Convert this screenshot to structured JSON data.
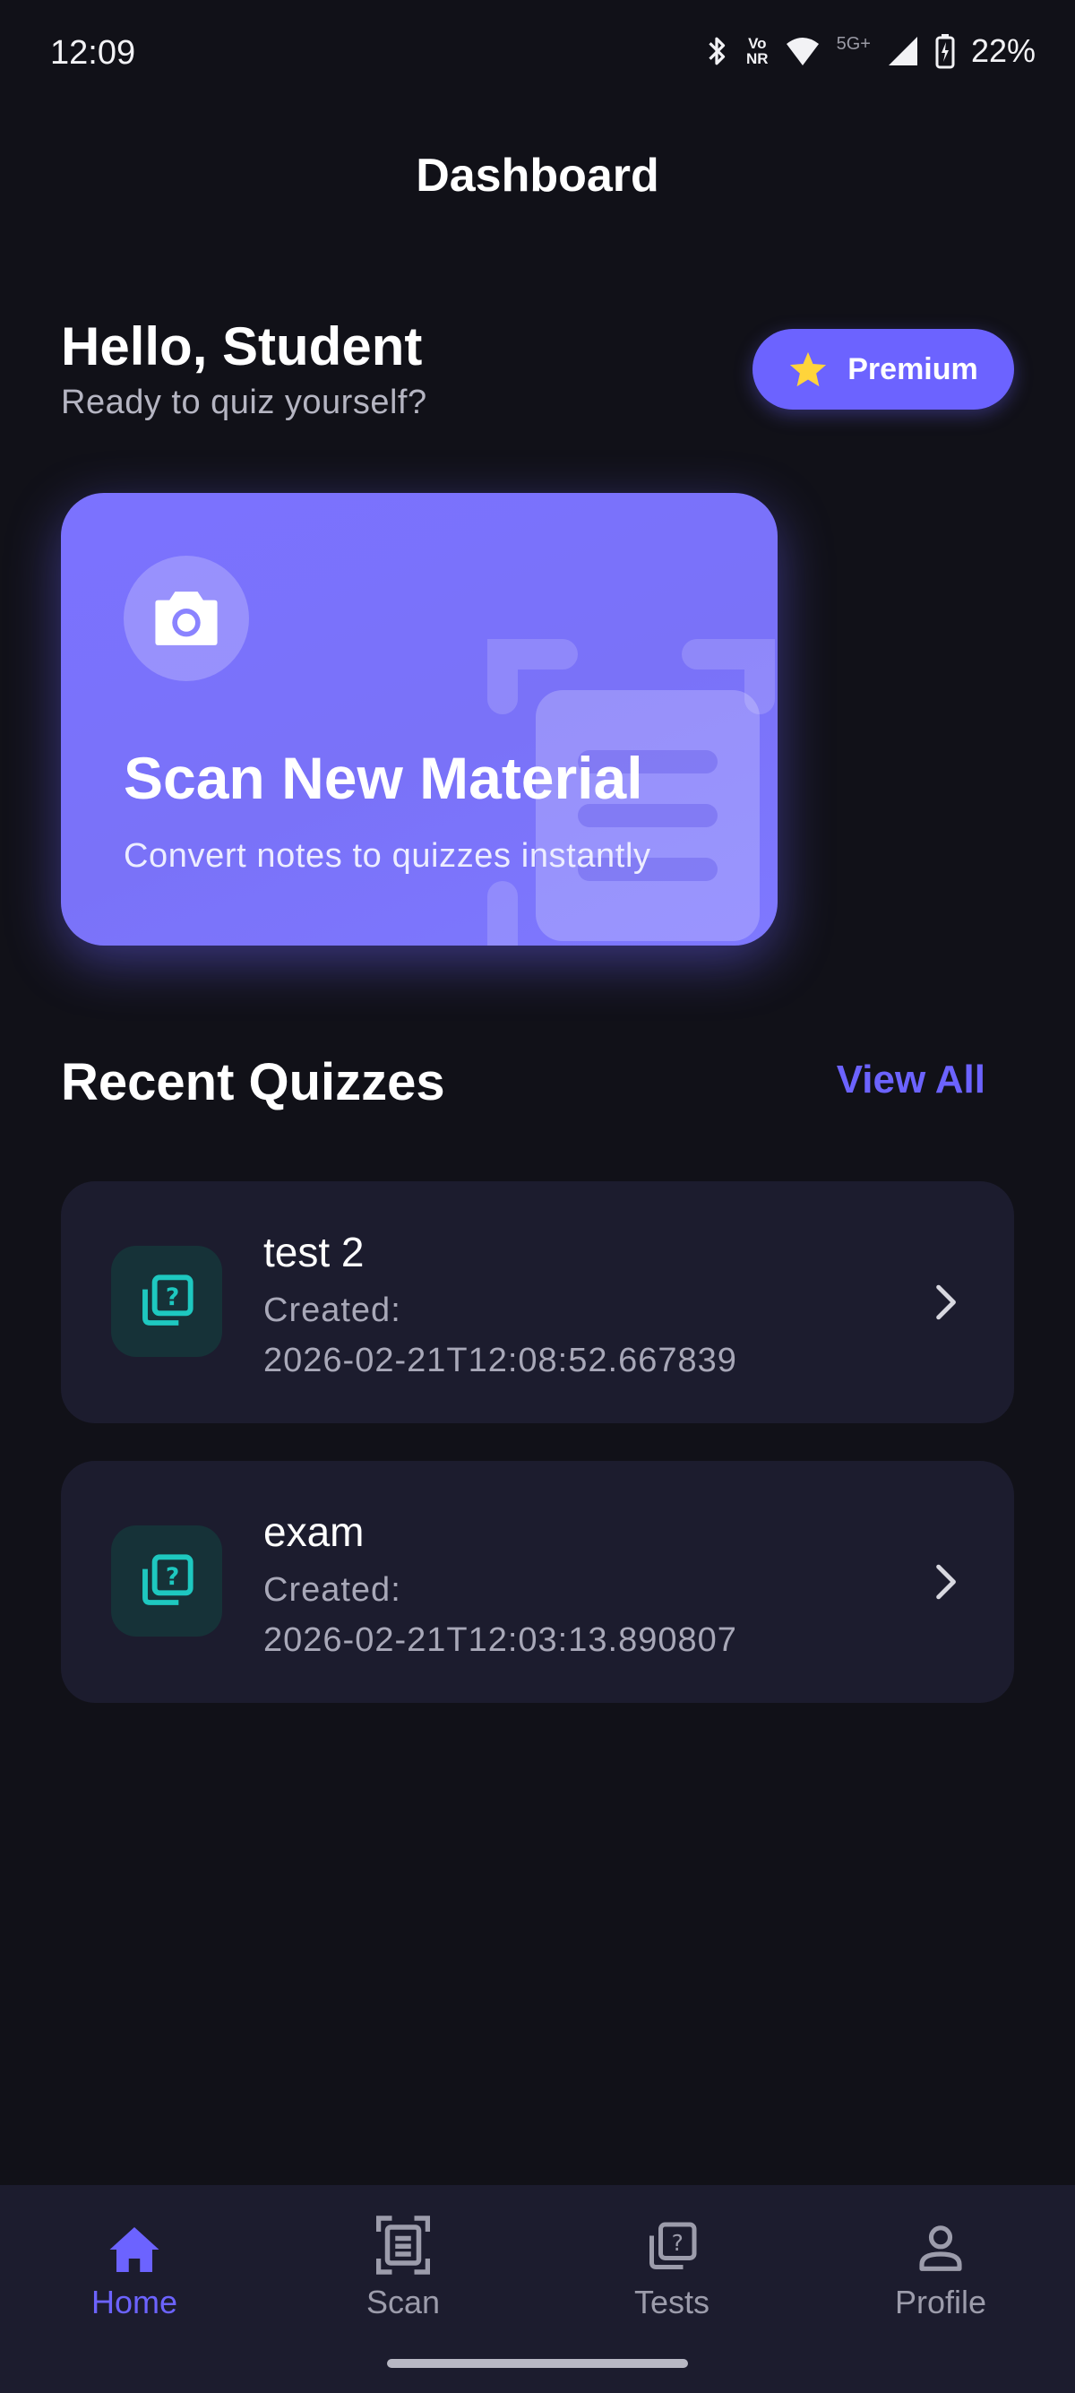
{
  "status_bar": {
    "time": "12:09",
    "volte_top": "Vo",
    "volte_bottom": "NR",
    "network": "5G+",
    "battery": "22%"
  },
  "header": {
    "title": "Dashboard"
  },
  "greeting": {
    "title": "Hello, Student",
    "subtitle": "Ready to quiz yourself?"
  },
  "premium": {
    "label": "Premium",
    "icon": "star-icon"
  },
  "scan_card": {
    "title": "Scan New Material",
    "subtitle": "Convert notes to quizzes instantly",
    "icon": "camera-icon"
  },
  "recent": {
    "title": "Recent Quizzes",
    "view_all": "View All"
  },
  "quizzes": [
    {
      "name": "test 2",
      "created_label": "Created:",
      "created_value": "2026-02-21T12:08:52.667839"
    },
    {
      "name": "exam",
      "created_label": "Created:",
      "created_value": "2026-02-21T12:03:13.890807"
    }
  ],
  "nav": [
    {
      "label": "Home",
      "icon": "home-icon",
      "active": true
    },
    {
      "label": "Scan",
      "icon": "scan-document-icon",
      "active": false
    },
    {
      "label": "Tests",
      "icon": "quiz-icon",
      "active": false
    },
    {
      "label": "Profile",
      "icon": "person-icon",
      "active": false
    }
  ],
  "colors": {
    "background": "#111118",
    "accent": "#6c63ff",
    "card": "#1c1c2e",
    "teal": "#1ec8c0",
    "star": "#ffd43b"
  }
}
